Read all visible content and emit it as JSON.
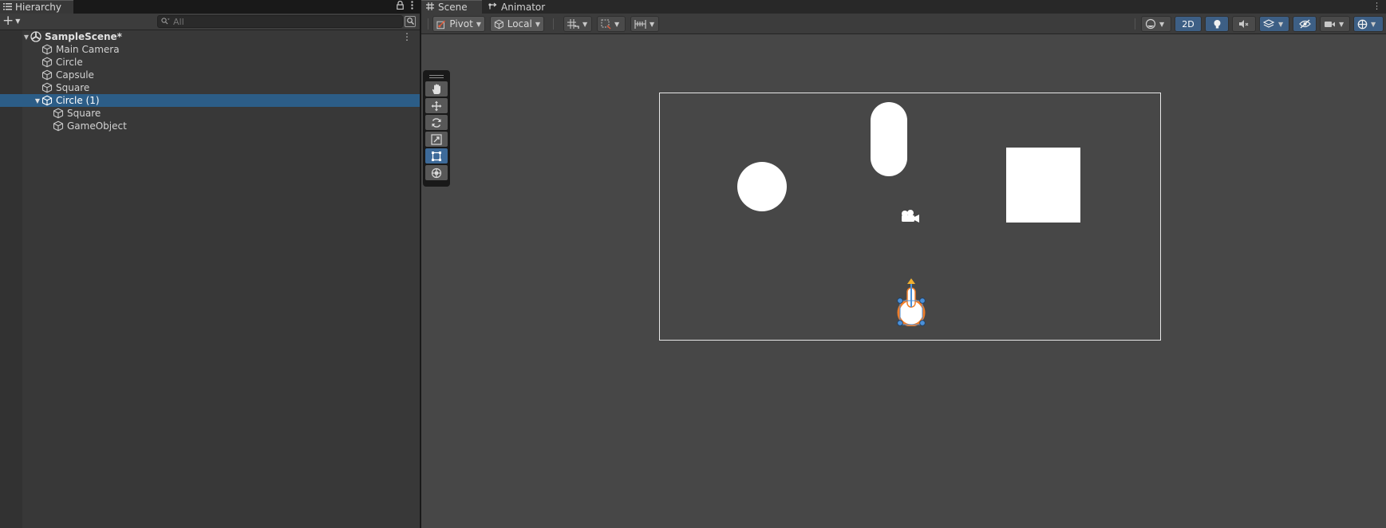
{
  "hierarchy": {
    "tab_label": "Hierarchy",
    "search_placeholder": "All",
    "scene_name": "SampleScene*",
    "items": [
      {
        "label": "Main Camera"
      },
      {
        "label": "Circle"
      },
      {
        "label": "Capsule"
      },
      {
        "label": "Square"
      },
      {
        "label": "Circle (1)",
        "selected": true,
        "expanded": true
      },
      {
        "label": "Square",
        "child": true
      },
      {
        "label": "GameObject",
        "child": true
      }
    ]
  },
  "scene": {
    "tabs": [
      {
        "label": "Scene",
        "icon": "grid-icon",
        "active": true
      },
      {
        "label": "Animator",
        "icon": "animator-icon"
      }
    ],
    "toolbar": {
      "pivot_label": "Pivot",
      "local_label": "Local",
      "mode_2d_label": "2D"
    }
  },
  "colors": {
    "selection": "#2c5d87",
    "active_tool": "#3d6a99",
    "panel": "#383838",
    "scene_background": "#474747",
    "gizmo_orange": "#f07d28",
    "gizmo_blue": "#4a90d9"
  }
}
